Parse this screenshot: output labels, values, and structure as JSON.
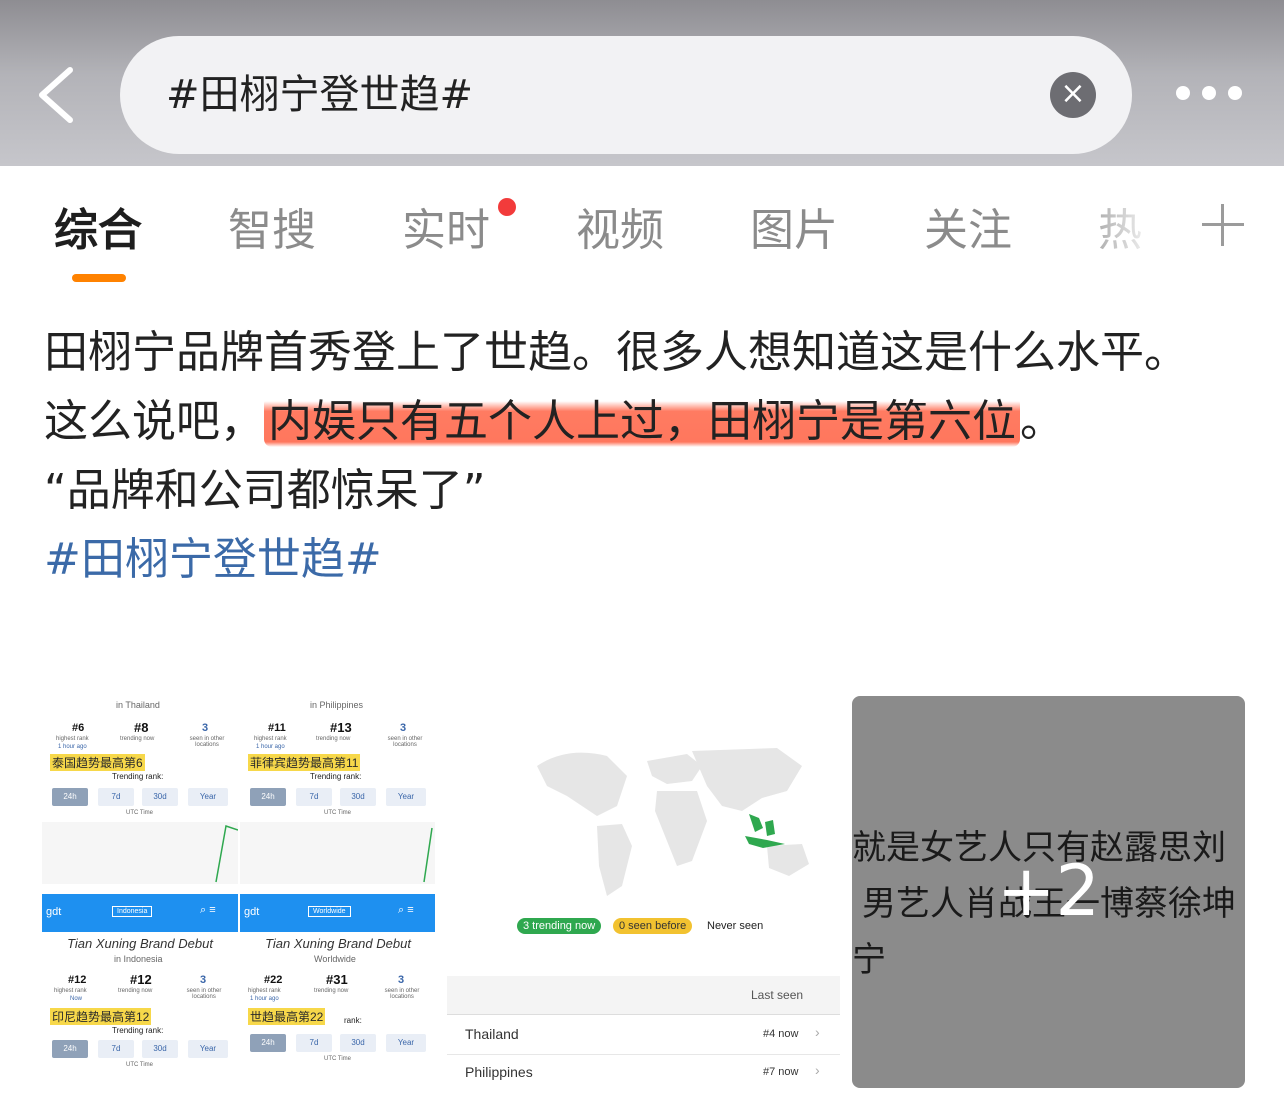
{
  "header": {
    "search_value": "#田栩宁登世趋#",
    "clear_label": "×"
  },
  "tabs": [
    {
      "label": "综合",
      "active": true
    },
    {
      "label": "智搜"
    },
    {
      "label": "实时",
      "badge": true
    },
    {
      "label": "视频"
    },
    {
      "label": "图片"
    },
    {
      "label": "关注"
    },
    {
      "label": "热"
    }
  ],
  "post": {
    "line1": "田栩宁品牌首秀登上了世趋。很多人想知道这是什么水平。",
    "line2_prefix": "这么说吧，",
    "line2_highlight": "内娱只有五个人上过，田栩宁是第六位",
    "line2_suffix": "。",
    "line3": "“品牌和公司都惊呆了”",
    "hashtag": "#田栩宁登世趋#"
  },
  "images": {
    "image1": {
      "panels": [
        {
          "location": "in Thailand",
          "highest_rank": "#6",
          "highest_label": "highest rank",
          "highest_time": "1 hour ago",
          "trending_now": "#8",
          "trending_label": "trending now",
          "seen": "3",
          "seen_label": "seen in other locations",
          "caption": "泰国趋势最高第6",
          "trend_rank": "Trending rank:",
          "periods": [
            "24h",
            "7d",
            "30d",
            "Year"
          ],
          "axis": "UTC Time"
        },
        {
          "location": "in Philippines",
          "highest_rank": "#11",
          "highest_label": "highest rank",
          "highest_time": "1 hour ago",
          "trending_now": "#13",
          "trending_label": "trending now",
          "seen": "3",
          "seen_label": "seen in other locations",
          "caption": "菲律宾趋势最高第11",
          "trend_rank": "Trending rank:",
          "periods": [
            "24h",
            "7d",
            "30d",
            "Year"
          ],
          "axis": "UTC Time"
        },
        {
          "location": "in Indonesia",
          "title": "Tian Xuning Brand Debut",
          "dropdown": "Indonesia",
          "brand": "gdt",
          "highest_rank": "#12",
          "highest_label": "highest rank",
          "highest_time": "Now",
          "trending_now": "#12",
          "trending_label": "trending now",
          "seen": "3",
          "seen_label": "seen in other locations",
          "caption": "印尼趋势最高第12",
          "trend_rank": "Trending rank:",
          "periods": [
            "24h",
            "7d",
            "30d",
            "Year"
          ],
          "axis": "UTC Time"
        },
        {
          "location": "Worldwide",
          "title": "Tian Xuning Brand Debut",
          "dropdown": "Worldwide",
          "brand": "gdt",
          "highest_rank": "#22",
          "highest_label": "highest rank",
          "highest_time": "1 hour ago",
          "trending_now": "#31",
          "trending_label": "trending now",
          "seen": "3",
          "seen_label": "seen in other locations",
          "caption": "世趋最高第22",
          "trend_rank": "rank:",
          "periods": [
            "24h",
            "7d",
            "30d",
            "Year"
          ],
          "axis": "UTC Time"
        }
      ]
    },
    "image2": {
      "legend": {
        "trending": "3 trending now",
        "seen": "0 seen before",
        "never": "Never seen"
      },
      "table_header": "Last seen",
      "rows": [
        {
          "name": "Thailand",
          "rank": "#4 now"
        },
        {
          "name": "Philippines",
          "rank": "#7 now"
        }
      ],
      "colors": {
        "trending": "#2fa84f",
        "seen": "#f2c230",
        "land": "#e6e6e6"
      }
    },
    "image3": {
      "text_line1": "就是女艺人只有赵露思刘",
      "text_line2": "男艺人肖战王一博蔡徐坤",
      "text_line3": "宁",
      "more_count": "+2"
    }
  }
}
